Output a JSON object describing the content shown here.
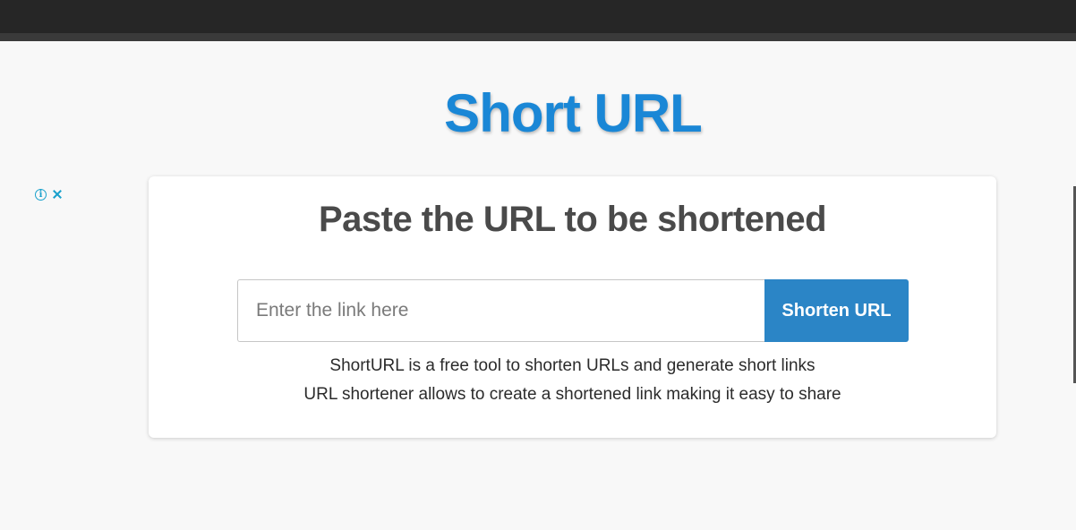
{
  "header": {
    "site_title": "Short URL"
  },
  "ad": {
    "info_icon": "info-icon",
    "close_icon": "close-icon"
  },
  "card": {
    "heading": "Paste the URL to be shortened",
    "input_placeholder": "Enter the link here",
    "input_value": "",
    "button_label": "Shorten URL",
    "description_line1": "ShortURL is a free tool to shorten URLs and generate short links",
    "description_line2": "URL shortener allows to create a shortened link making it easy to share"
  },
  "colors": {
    "title_blue": "#1a87d6",
    "button_blue": "#2b85c6",
    "topbar": "#262626",
    "background": "#f8f8f8",
    "ad_icon": "#1aa1cc"
  }
}
